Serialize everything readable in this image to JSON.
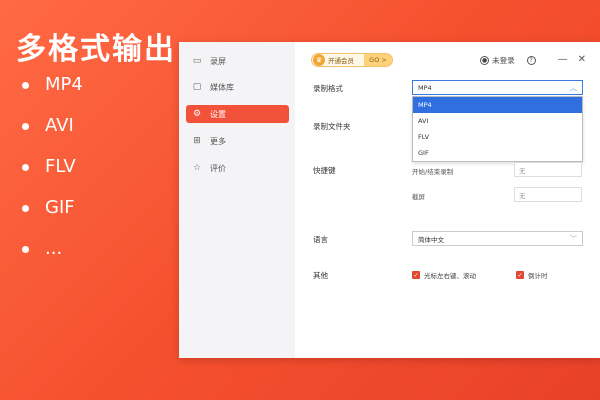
{
  "promo": {
    "title": "多格式输出",
    "formats": [
      "MP4",
      "AVI",
      "FLV",
      "GIF",
      "..."
    ]
  },
  "sidebar": {
    "items": [
      {
        "label": "录屏",
        "icon": "video-icon"
      },
      {
        "label": "媒体库",
        "icon": "folder-icon"
      },
      {
        "label": "设置",
        "icon": "settings-icon"
      },
      {
        "label": "更多",
        "icon": "grid-icon"
      },
      {
        "label": "评价",
        "icon": "star-icon"
      }
    ],
    "active": "设置"
  },
  "topbar": {
    "vip_label": "开通会员",
    "vip_go": "GO >",
    "login": "未登录",
    "help": "?",
    "minimize": "—",
    "close": "✕"
  },
  "settings": {
    "format_label": "录制格式",
    "format_value": "MP4",
    "format_options": [
      "MP4",
      "AVI",
      "FLV",
      "GIF"
    ],
    "folder_label": "录制文件夹",
    "hotkey_label": "快捷键",
    "hotkey_record_label": "开始/结束录制",
    "hotkey_record_value": "无",
    "hotkey_screenshot_label": "截屏",
    "hotkey_screenshot_value": "无",
    "language_label": "语言",
    "language_value": "简体中文",
    "other_label": "其他",
    "option_cursor": "光标左右键、滚动",
    "option_countdown": "倒计时"
  },
  "colors": {
    "accent": "#f2523a",
    "selection": "#2f6fe0"
  }
}
